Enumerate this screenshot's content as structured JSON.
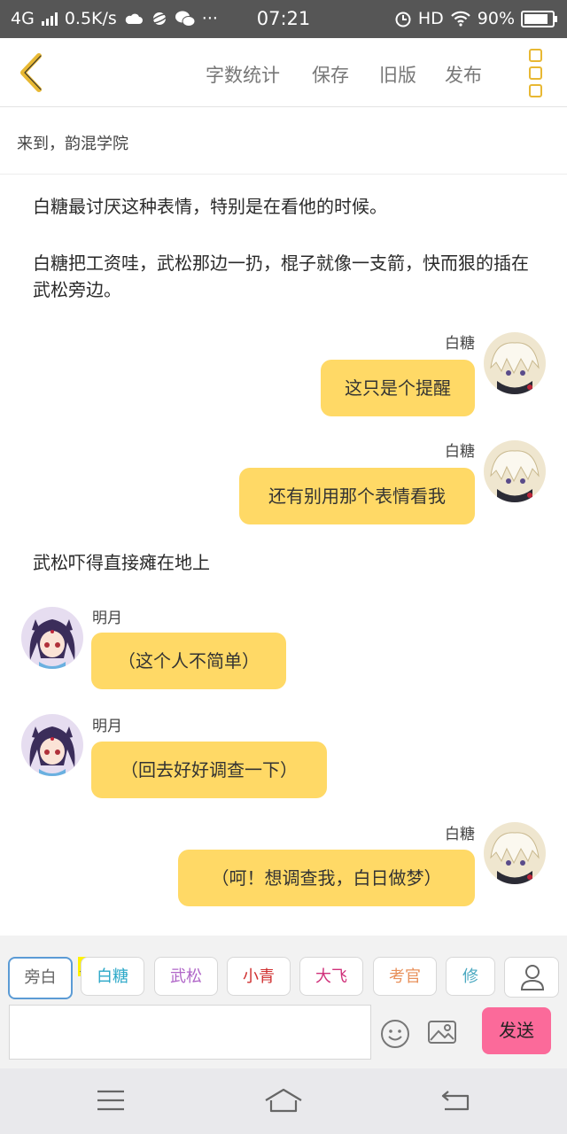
{
  "status": {
    "network": "4G",
    "speed": "0.5K/s",
    "time": "07:21",
    "hd": "HD",
    "battery": "90%",
    "battery_level": 0.9
  },
  "toolbar": {
    "word_count": "字数统计",
    "save": "保存",
    "old_version": "旧版",
    "publish": "发布"
  },
  "location": "来到，韵混学院",
  "story": {
    "narration1": "白糖最讨厌这种表情，特别是在看他的时候。",
    "narration2": "白糖把工资哇，武松那边一扔，棍子就像一支箭，快而狠的插在武松旁边。",
    "msg1": {
      "speaker": "白糖",
      "text": "这只是个提醒"
    },
    "msg2": {
      "speaker": "白糖",
      "text": "还有别用那个表情看我"
    },
    "narration3": "武松吓得直接瘫在地上",
    "msg3": {
      "speaker": "明月",
      "text": "（这个人不简单）"
    },
    "msg4": {
      "speaker": "明月",
      "text": "（回去好好调查一下）"
    },
    "msg5": {
      "speaker": "白糖",
      "text": "（呵！想调查我，白日做梦）"
    }
  },
  "characters": {
    "narrator": "旁白",
    "host_badge": "主",
    "c1": {
      "label": "白糖",
      "color": "#2ba8c8"
    },
    "c2": {
      "label": "武松",
      "color": "#b066c8"
    },
    "c3": {
      "label": "小青",
      "color": "#d03030"
    },
    "c4": {
      "label": "大飞",
      "color": "#d0307a"
    },
    "c5": {
      "label": "考官",
      "color": "#e8905a"
    },
    "c6": {
      "label": "修",
      "color": "#4aa8c0"
    }
  },
  "input": {
    "value": "",
    "send": "发送"
  },
  "colors": {
    "accent": "#ffd966",
    "send_button": "#fb6a9a",
    "icon_yellow": "#e8b833"
  }
}
